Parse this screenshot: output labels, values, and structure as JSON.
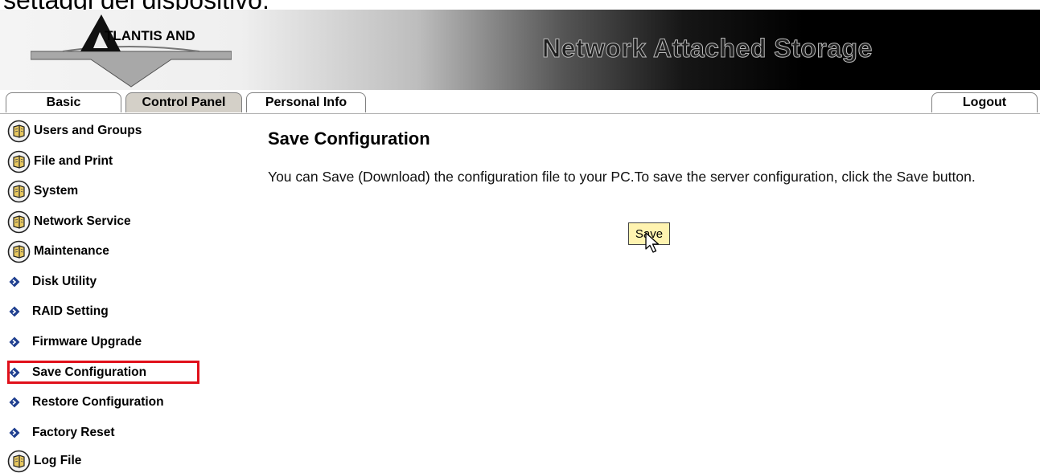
{
  "caption": "settaggi del dispositivo.",
  "header": {
    "logo_text": "TLANTIS AND",
    "title": "Network Attached Storage"
  },
  "tabs": [
    {
      "label": "Basic"
    },
    {
      "label": "Control Panel",
      "active": true
    },
    {
      "label": "Personal Info"
    }
  ],
  "logout_label": "Logout",
  "sidebar": {
    "items": [
      {
        "label": "Users and Groups",
        "icon": "book-icon"
      },
      {
        "label": "File and Print",
        "icon": "book-icon"
      },
      {
        "label": "System",
        "icon": "book-icon"
      },
      {
        "label": "Network Service",
        "icon": "book-icon"
      },
      {
        "label": "Maintenance",
        "icon": "book-icon"
      },
      {
        "label": "Disk Utility",
        "icon": "diamond-bullet-icon"
      },
      {
        "label": "RAID Setting",
        "icon": "diamond-bullet-icon"
      },
      {
        "label": "Firmware Upgrade",
        "icon": "diamond-bullet-icon"
      },
      {
        "label": "Save Configuration",
        "icon": "diamond-bullet-icon",
        "highlighted": true
      },
      {
        "label": "Restore Configuration",
        "icon": "diamond-bullet-icon"
      },
      {
        "label": "Factory Reset",
        "icon": "diamond-bullet-icon"
      },
      {
        "label": "Log File",
        "icon": "book-icon"
      }
    ]
  },
  "main": {
    "title": "Save Configuration",
    "description": "You can Save (Download) the configuration file to your PC.To save the server configuration, click the Save button.",
    "save_button": "Save"
  },
  "colors": {
    "highlight_border": "#e0101a",
    "save_button_bg": "#fff3b0",
    "active_tab_bg": "#d4d0c8",
    "bullet_blue": "#1f3f8f"
  }
}
